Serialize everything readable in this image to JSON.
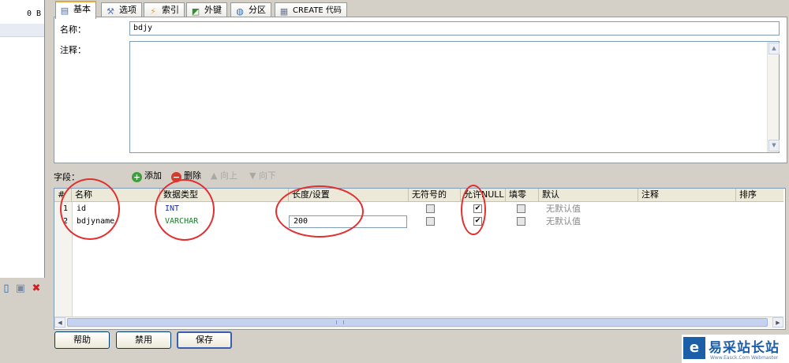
{
  "left": {
    "size_label": "0 B"
  },
  "tabs": [
    {
      "label": "基本",
      "icon": "table-icon"
    },
    {
      "label": "选项",
      "icon": "wrench-icon"
    },
    {
      "label": "索引",
      "icon": "lightning-icon"
    },
    {
      "label": "外键",
      "icon": "chart-icon"
    },
    {
      "label": "分区",
      "icon": "globe-icon"
    },
    {
      "label": "CREATE 代码",
      "icon": "document-icon"
    }
  ],
  "basic": {
    "name_label": "名称：",
    "name_value": "bdjy",
    "comment_label": "注释："
  },
  "fields_toolbar": {
    "label": "字段：",
    "add": "添加",
    "delete": "删除",
    "up": "向上",
    "down": "向下"
  },
  "grid": {
    "columns": [
      "#",
      "名称",
      "数据类型",
      "长度/设置",
      "无符号的",
      "允许NULL",
      "填零",
      "默认",
      "注释",
      "排序"
    ],
    "rows": [
      {
        "num": "1",
        "name": "id",
        "type": "INT",
        "length": "",
        "unsigned": false,
        "allow_null": true,
        "zerofill": false,
        "default": "无默认值",
        "comment": ""
      },
      {
        "num": "2",
        "name": "bdjyname",
        "type": "VARCHAR",
        "length": "200",
        "unsigned": false,
        "allow_null": true,
        "zerofill": false,
        "default": "无默认值",
        "comment": ""
      }
    ]
  },
  "buttons": {
    "help": "帮助",
    "disable": "禁用",
    "save": "保存"
  },
  "watermark": {
    "text": "易采站长站",
    "sub": "Www.Easck.Com Webmaster"
  },
  "colors": {
    "annotation": "#e03030",
    "accent_tab": "#e6a73c",
    "watermark": "#1c5fa8"
  }
}
